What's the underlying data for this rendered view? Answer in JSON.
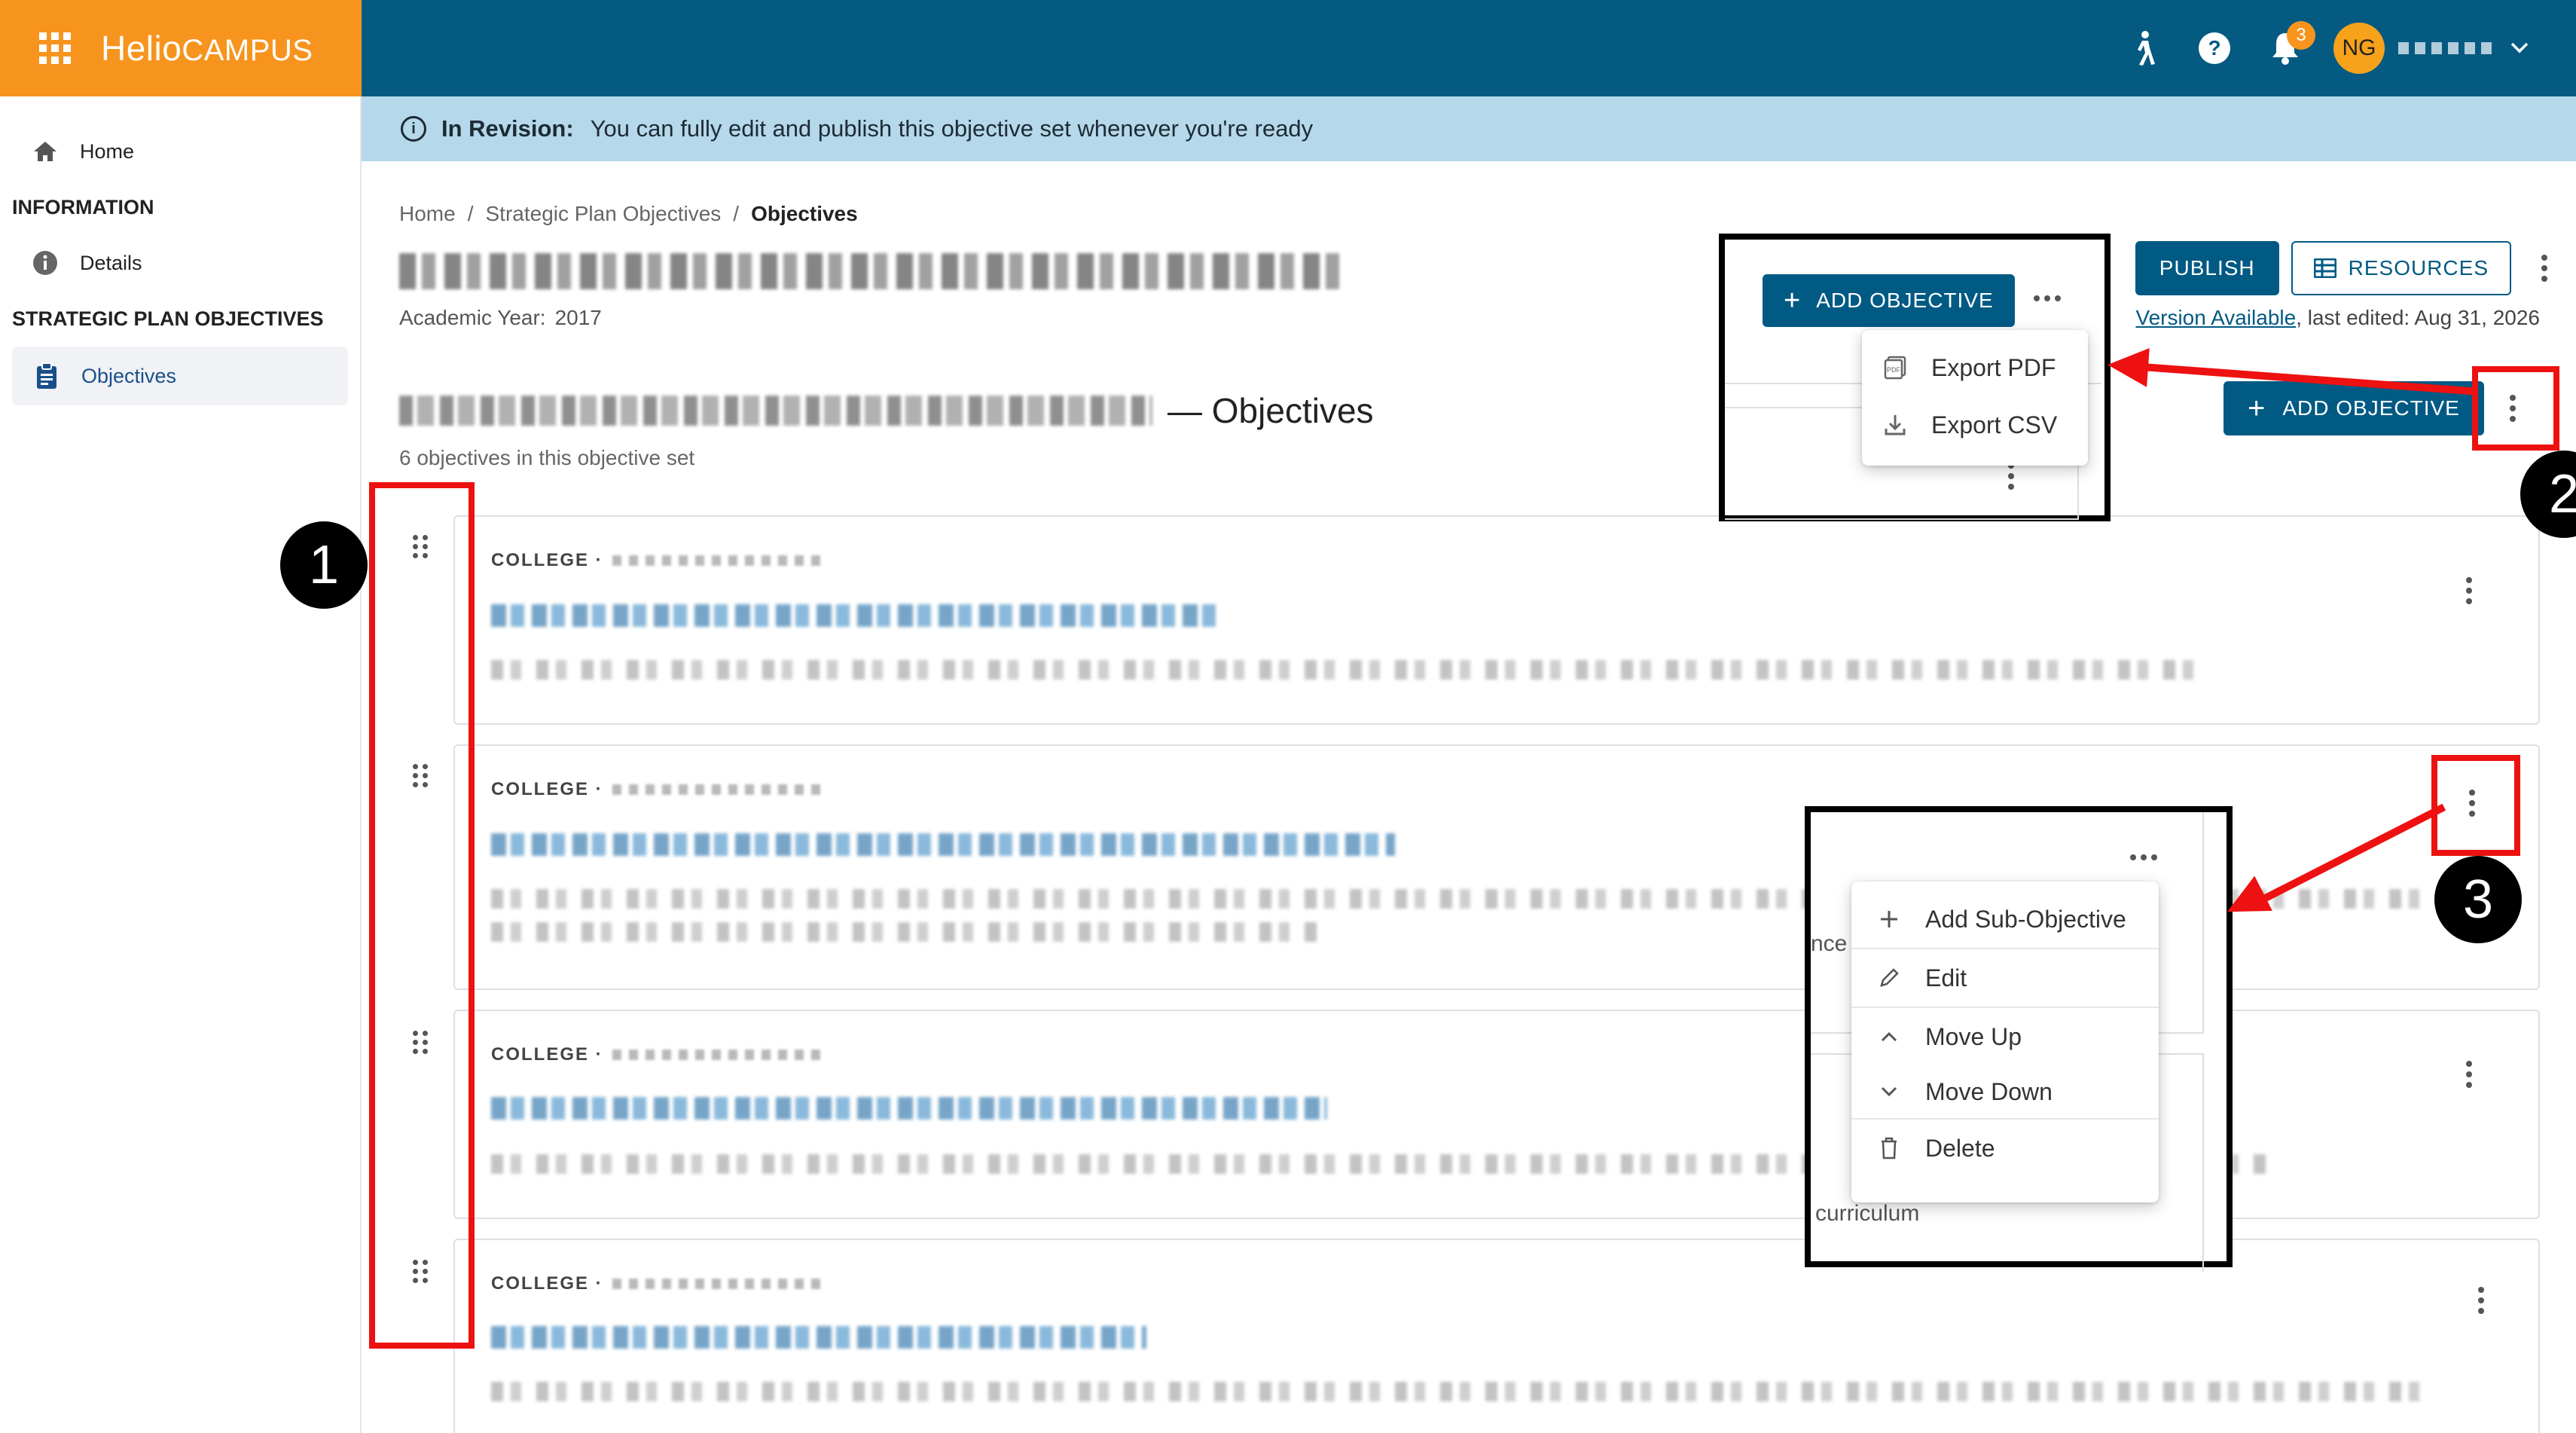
{
  "brand": {
    "name": "Helio",
    "name_suffix": "CAMPUS"
  },
  "topbar": {
    "notification_count": "3",
    "avatar_initials": "NG"
  },
  "sidebar": {
    "items": [
      {
        "label": "Home",
        "icon": "home-icon"
      }
    ],
    "section_information": "INFORMATION",
    "details_label": "Details",
    "section_objectives": "STRATEGIC PLAN OBJECTIVES",
    "objectives_label": "Objectives"
  },
  "banner": {
    "status": "In Revision:",
    "message": "You can fully edit and publish this objective set whenever you're ready"
  },
  "breadcrumb": [
    "Home",
    "Strategic Plan Objectives",
    "Objectives"
  ],
  "header": {
    "academic_year_label": "Academic Year:",
    "academic_year": "2017",
    "publish_label": "PUBLISH",
    "resources_label": "RESOURCES",
    "version_link": "Version Available",
    "version_rest": ", last edited: Aug 31, 2026"
  },
  "objectives_section": {
    "title_suffix": "— Objectives",
    "count_text": "6 objectives in this objective set",
    "add_objective_label": "ADD OBJECTIVE"
  },
  "cards": [
    {
      "college": "COLLEGE ·"
    },
    {
      "college": "COLLEGE ·"
    },
    {
      "college": "COLLEGE ·"
    },
    {
      "college": "COLLEGE ·"
    }
  ],
  "export_menu": {
    "add_objective_label": "ADD OBJECTIVE",
    "items": [
      "Export PDF",
      "Export CSV"
    ]
  },
  "card_menu": {
    "items": [
      "Add Sub-Objective",
      "Edit",
      "Move Up",
      "Move Down",
      "Delete"
    ],
    "behind_text_1": "nce",
    "behind_text_2": "curriculum"
  },
  "callouts": [
    "1",
    "2",
    "3"
  ],
  "colors": {
    "topbar": "#055a82",
    "brand": "#f7941d",
    "banner": "#b5d8ea",
    "primary": "#005a84",
    "annotation_red": "#ee1111"
  }
}
